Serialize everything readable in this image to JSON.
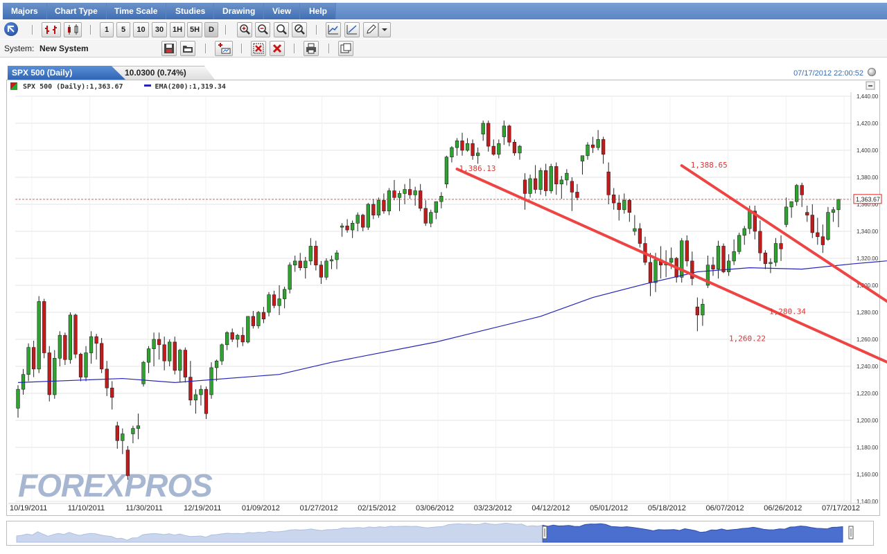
{
  "menu": {
    "items": [
      "Majors",
      "Chart Type",
      "Time Scale",
      "Studies",
      "Drawing",
      "View",
      "Help"
    ]
  },
  "toolbar": {
    "timeframes": [
      "1",
      "5",
      "10",
      "30",
      "1H",
      "5H",
      "D"
    ],
    "system_label": "System:",
    "system_value": "New System"
  },
  "tab": {
    "title": "SPX 500 (Daily)",
    "change": "10.0300 (0.74%)",
    "timestamp": "07/17/2012 22:00:52"
  },
  "legend": {
    "series1": "SPX 500 (Daily):1,363.67",
    "series2": "EMA(200):1,319.34"
  },
  "watermark": "FOREXPROS",
  "colors": {
    "up": "#2fa32f",
    "down": "#c21b1b",
    "ema": "#2424b8",
    "trendline": "#ee4444",
    "menubar": "#4a78bd",
    "accent": "#3b6bb0"
  },
  "chart_data": {
    "type": "candlestick",
    "title": "SPX 500 (Daily)",
    "ylim": [
      1140,
      1440
    ],
    "y_ticks": [
      "1,440.00",
      "1,420.00",
      "1,400.00",
      "1,380.00",
      "1,360.00",
      "1,340.00",
      "1,320.00",
      "1,300.00",
      "1,280.00",
      "1,260.00",
      "1,240.00",
      "1,220.00",
      "1,200.00",
      "1,180.00",
      "1,160.00",
      "1,140.00"
    ],
    "x_ticks": [
      "10/19/2011",
      "11/10/2011",
      "11/30/2011",
      "12/19/2011",
      "01/09/2012",
      "01/27/2012",
      "02/15/2012",
      "03/06/2012",
      "03/23/2012",
      "04/12/2012",
      "05/01/2012",
      "05/18/2012",
      "06/07/2012",
      "06/26/2012",
      "07/17/2012"
    ],
    "last_price_label": "1,363.67",
    "last_price": 1363.67,
    "ema_period": 200,
    "ema_points": [
      [
        0,
        1228
      ],
      [
        20,
        1231
      ],
      [
        30,
        1228
      ],
      [
        50,
        1234
      ],
      [
        60,
        1243
      ],
      [
        80,
        1258
      ],
      [
        100,
        1277
      ],
      [
        110,
        1291
      ],
      [
        120,
        1301
      ],
      [
        130,
        1310
      ],
      [
        140,
        1313
      ],
      [
        150,
        1312
      ],
      [
        160,
        1316
      ],
      [
        170,
        1319.34
      ]
    ],
    "candle_ohlc": [
      [
        1209,
        1226,
        1202,
        1223
      ],
      [
        1223,
        1238,
        1219,
        1234
      ],
      [
        1234,
        1257,
        1229,
        1254
      ],
      [
        1254,
        1259,
        1232,
        1238
      ],
      [
        1238,
        1292,
        1235,
        1288
      ],
      [
        1288,
        1290,
        1246,
        1250
      ],
      [
        1250,
        1255,
        1214,
        1219
      ],
      [
        1219,
        1252,
        1216,
        1246
      ],
      [
        1246,
        1266,
        1240,
        1263
      ],
      [
        1263,
        1265,
        1241,
        1245
      ],
      [
        1245,
        1280,
        1242,
        1278
      ],
      [
        1278,
        1279,
        1246,
        1249
      ],
      [
        1249,
        1250,
        1229,
        1232
      ],
      [
        1232,
        1255,
        1229,
        1250
      ],
      [
        1250,
        1266,
        1242,
        1262
      ],
      [
        1262,
        1264,
        1245,
        1257
      ],
      [
        1257,
        1261,
        1235,
        1238
      ],
      [
        1238,
        1244,
        1218,
        1224
      ],
      [
        1224,
        1229,
        1208,
        1217
      ],
      [
        1196,
        1199,
        1179,
        1185
      ],
      [
        1185,
        1194,
        1175,
        1190
      ],
      [
        1178,
        1181,
        1156,
        1159
      ],
      [
        1190,
        1196,
        1183,
        1194
      ],
      [
        1194,
        1205,
        1186,
        1196
      ],
      [
        1227,
        1244,
        1225,
        1243
      ],
      [
        1243,
        1255,
        1235,
        1253
      ],
      [
        1253,
        1265,
        1240,
        1260
      ],
      [
        1260,
        1265,
        1245,
        1256
      ],
      [
        1256,
        1262,
        1237,
        1244
      ],
      [
        1244,
        1260,
        1240,
        1258
      ],
      [
        1258,
        1262,
        1234,
        1237
      ],
      [
        1237,
        1253,
        1228,
        1252
      ],
      [
        1252,
        1254,
        1228,
        1232
      ],
      [
        1232,
        1244,
        1211,
        1215
      ],
      [
        1215,
        1223,
        1205,
        1219
      ],
      [
        1219,
        1226,
        1211,
        1223
      ],
      [
        1223,
        1225,
        1201,
        1205
      ],
      [
        1219,
        1243,
        1216,
        1239
      ],
      [
        1239,
        1245,
        1229,
        1244
      ],
      [
        1244,
        1257,
        1241,
        1256
      ],
      [
        1256,
        1266,
        1252,
        1265
      ],
      [
        1265,
        1268,
        1258,
        1260
      ],
      [
        1260,
        1264,
        1254,
        1263
      ],
      [
        1263,
        1269,
        1255,
        1258
      ],
      [
        1258,
        1277,
        1257,
        1277
      ],
      [
        1277,
        1281,
        1268,
        1270
      ],
      [
        1270,
        1281,
        1268,
        1280
      ],
      [
        1280,
        1284,
        1272,
        1275
      ],
      [
        1280,
        1295,
        1277,
        1293
      ],
      [
        1293,
        1296,
        1283,
        1285
      ],
      [
        1285,
        1300,
        1278,
        1290
      ],
      [
        1290,
        1299,
        1283,
        1297
      ],
      [
        1297,
        1317,
        1294,
        1315
      ],
      [
        1315,
        1322,
        1310,
        1318
      ],
      [
        1318,
        1324,
        1311,
        1313
      ],
      [
        1313,
        1321,
        1305,
        1318
      ],
      [
        1318,
        1335,
        1315,
        1329
      ],
      [
        1329,
        1333,
        1311,
        1315
      ],
      [
        1315,
        1318,
        1301,
        1306
      ],
      [
        1306,
        1320,
        1304,
        1318
      ],
      [
        1318,
        1322,
        1312,
        1319
      ],
      [
        1319,
        1326,
        1312,
        1324
      ],
      [
        1343,
        1346,
        1336,
        1344
      ],
      [
        1344,
        1349,
        1339,
        1341
      ],
      [
        1341,
        1348,
        1335,
        1346
      ],
      [
        1346,
        1354,
        1340,
        1352
      ],
      [
        1352,
        1353,
        1340,
        1343
      ],
      [
        1343,
        1361,
        1341,
        1360
      ],
      [
        1360,
        1364,
        1349,
        1352
      ],
      [
        1352,
        1365,
        1350,
        1363
      ],
      [
        1363,
        1368,
        1353,
        1355
      ],
      [
        1355,
        1372,
        1352,
        1370
      ],
      [
        1370,
        1378,
        1363,
        1365
      ],
      [
        1365,
        1370,
        1355,
        1368
      ],
      [
        1368,
        1375,
        1360,
        1371
      ],
      [
        1371,
        1379,
        1364,
        1367
      ],
      [
        1367,
        1373,
        1359,
        1370
      ],
      [
        1370,
        1375,
        1355,
        1357
      ],
      [
        1357,
        1363,
        1344,
        1346
      ],
      [
        1346,
        1356,
        1343,
        1354
      ],
      [
        1354,
        1358,
        1349,
        1362
      ],
      [
        1362,
        1369,
        1357,
        1366
      ],
      [
        1375,
        1396,
        1372,
        1395
      ],
      [
        1395,
        1403,
        1391,
        1402
      ],
      [
        1402,
        1409,
        1396,
        1407
      ],
      [
        1407,
        1413,
        1396,
        1400
      ],
      [
        1400,
        1409,
        1399,
        1405
      ],
      [
        1405,
        1408,
        1393,
        1396
      ],
      [
        1396,
        1402,
        1390,
        1398
      ],
      [
        1412,
        1422,
        1407,
        1420
      ],
      [
        1420,
        1422,
        1399,
        1403
      ],
      [
        1403,
        1408,
        1396,
        1397
      ],
      [
        1397,
        1408,
        1394,
        1405
      ],
      [
        1410,
        1422,
        1404,
        1418
      ],
      [
        1418,
        1419,
        1403,
        1406
      ],
      [
        1406,
        1408,
        1396,
        1398
      ],
      [
        1398,
        1404,
        1393,
        1403
      ],
      [
        1378,
        1383,
        1356,
        1368
      ],
      [
        1368,
        1382,
        1365,
        1379
      ],
      [
        1379,
        1389,
        1368,
        1371
      ],
      [
        1371,
        1387,
        1367,
        1385
      ],
      [
        1385,
        1390,
        1366,
        1370
      ],
      [
        1370,
        1390,
        1368,
        1388
      ],
      [
        1388,
        1391,
        1367,
        1375
      ],
      [
        1375,
        1381,
        1364,
        1378
      ],
      [
        1378,
        1386,
        1374,
        1383
      ],
      [
        1377,
        1380,
        1355,
        1369
      ],
      [
        1369,
        1375,
        1363,
        1365
      ],
      [
        1392,
        1395,
        1382,
        1396
      ],
      [
        1396,
        1406,
        1393,
        1404
      ],
      [
        1404,
        1410,
        1398,
        1402
      ],
      [
        1402,
        1415,
        1400,
        1408
      ],
      [
        1408,
        1410,
        1390,
        1397
      ],
      [
        1384,
        1391,
        1360,
        1367
      ],
      [
        1367,
        1372,
        1356,
        1361
      ],
      [
        1361,
        1367,
        1348,
        1356
      ],
      [
        1356,
        1368,
        1353,
        1363
      ],
      [
        1363,
        1364,
        1347,
        1354
      ],
      [
        1340,
        1352,
        1337,
        1342
      ],
      [
        1342,
        1346,
        1328,
        1331
      ],
      [
        1331,
        1336,
        1315,
        1317
      ],
      [
        1317,
        1324,
        1292,
        1302
      ],
      [
        1302,
        1324,
        1295,
        1319
      ],
      [
        1319,
        1329,
        1305,
        1315
      ],
      [
        1315,
        1326,
        1306,
        1317
      ],
      [
        1317,
        1328,
        1312,
        1320
      ],
      [
        1320,
        1321,
        1302,
        1306
      ],
      [
        1306,
        1335,
        1302,
        1333
      ],
      [
        1333,
        1337,
        1314,
        1318
      ],
      [
        1318,
        1325,
        1300,
        1305
      ],
      [
        1284,
        1291,
        1266,
        1278
      ],
      [
        1278,
        1290,
        1270,
        1286
      ],
      [
        1300,
        1322,
        1298,
        1315
      ],
      [
        1315,
        1321,
        1307,
        1312
      ],
      [
        1312,
        1333,
        1305,
        1329
      ],
      [
        1329,
        1331,
        1309,
        1310
      ],
      [
        1310,
        1323,
        1307,
        1318
      ],
      [
        1318,
        1334,
        1315,
        1325
      ],
      [
        1325,
        1339,
        1323,
        1337
      ],
      [
        1337,
        1344,
        1330,
        1342
      ],
      [
        1342,
        1359,
        1338,
        1355
      ],
      [
        1355,
        1359,
        1334,
        1340
      ],
      [
        1340,
        1348,
        1318,
        1324
      ],
      [
        1324,
        1326,
        1312,
        1316
      ],
      [
        1316,
        1320,
        1309,
        1317
      ],
      [
        1317,
        1335,
        1314,
        1331
      ],
      [
        1331,
        1337,
        1318,
        1327
      ],
      [
        1345,
        1365,
        1343,
        1358
      ],
      [
        1358,
        1362,
        1350,
        1362
      ],
      [
        1362,
        1375,
        1359,
        1374
      ],
      [
        1374,
        1376,
        1358,
        1367
      ],
      [
        1354,
        1359,
        1347,
        1352
      ],
      [
        1352,
        1360,
        1335,
        1339
      ],
      [
        1339,
        1350,
        1330,
        1336
      ],
      [
        1336,
        1345,
        1324,
        1330
      ],
      [
        1334,
        1358,
        1333,
        1354
      ],
      [
        1354,
        1358,
        1347,
        1356
      ],
      [
        1356,
        1364,
        1343,
        1363.67
      ]
    ],
    "trendlines": [
      {
        "label": "1,386.13",
        "from": [
          84,
          1386.13
        ],
        "to": [
          189,
          1203
        ]
      },
      {
        "label": "1,388.65",
        "from": [
          127,
          1388.65
        ],
        "to": [
          189,
          1229
        ]
      },
      {
        "label": "1,280.34",
        "at": 1280.34
      },
      {
        "label": "1,260.22",
        "at": 1260.22
      }
    ]
  }
}
